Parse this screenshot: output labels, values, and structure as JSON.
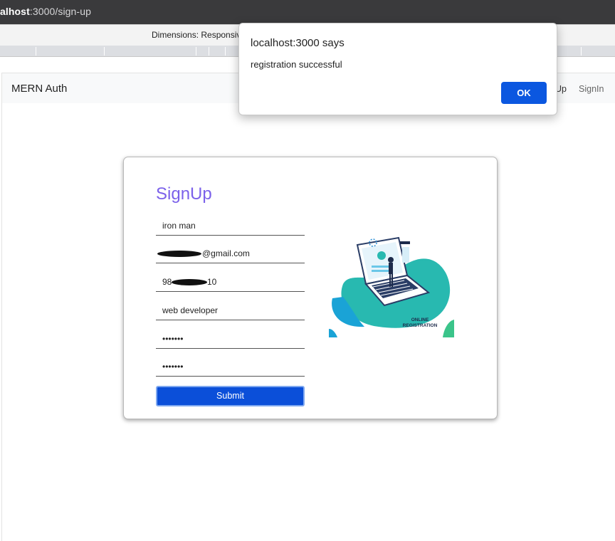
{
  "browser": {
    "url_host": "alhost",
    "url_rest": ":3000/sign-up"
  },
  "devtools": {
    "dimensions_label": "Dimensions: Responsive"
  },
  "navbar": {
    "brand": "MERN Auth",
    "signup_label": "nUp",
    "signin_label": "SignIn"
  },
  "form": {
    "title": "SignUp",
    "name_value": "iron man",
    "email_value": "@gmail.com",
    "phone_value_start": "98",
    "phone_value_end": "10",
    "work_value": "web developer",
    "password_value": "•••••••",
    "cpassword_value": "•••••••",
    "submit_label": "Submit"
  },
  "illustration": {
    "caption_line1": "ONLINE",
    "caption_line2": "REGISTRATION",
    "accent": "#2ab7a9"
  },
  "dialog": {
    "title": "localhost:3000 says",
    "message": "registration successful",
    "ok_label": "OK",
    "ok_color": "#0b57e0"
  }
}
